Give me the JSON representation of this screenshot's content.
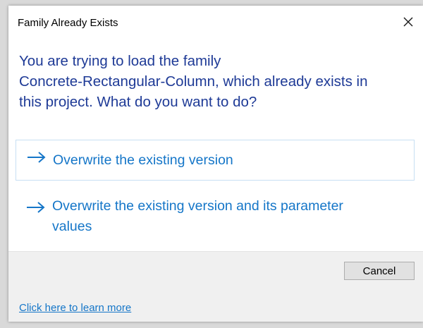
{
  "dialog": {
    "title": "Family Already Exists",
    "close_icon": "close-icon",
    "instruction_lines": [
      "You are trying to load the family",
      "Concrete-Rectangular-Column, which already exists in",
      "this project.  What do you want to do?"
    ],
    "options": [
      {
        "icon": "arrow-right-icon",
        "label": "Overwrite the existing version"
      },
      {
        "icon": "arrow-right-icon",
        "label_lines": [
          "Overwrite the existing version and its parameter",
          "values"
        ]
      }
    ],
    "cancel_label": "Cancel",
    "footer_link": "Click here to learn more"
  },
  "colors": {
    "instruction_text": "#1e3a96",
    "option_text": "#1576c8",
    "link": "#1576c8",
    "button_bar": "#f0f0f0"
  }
}
